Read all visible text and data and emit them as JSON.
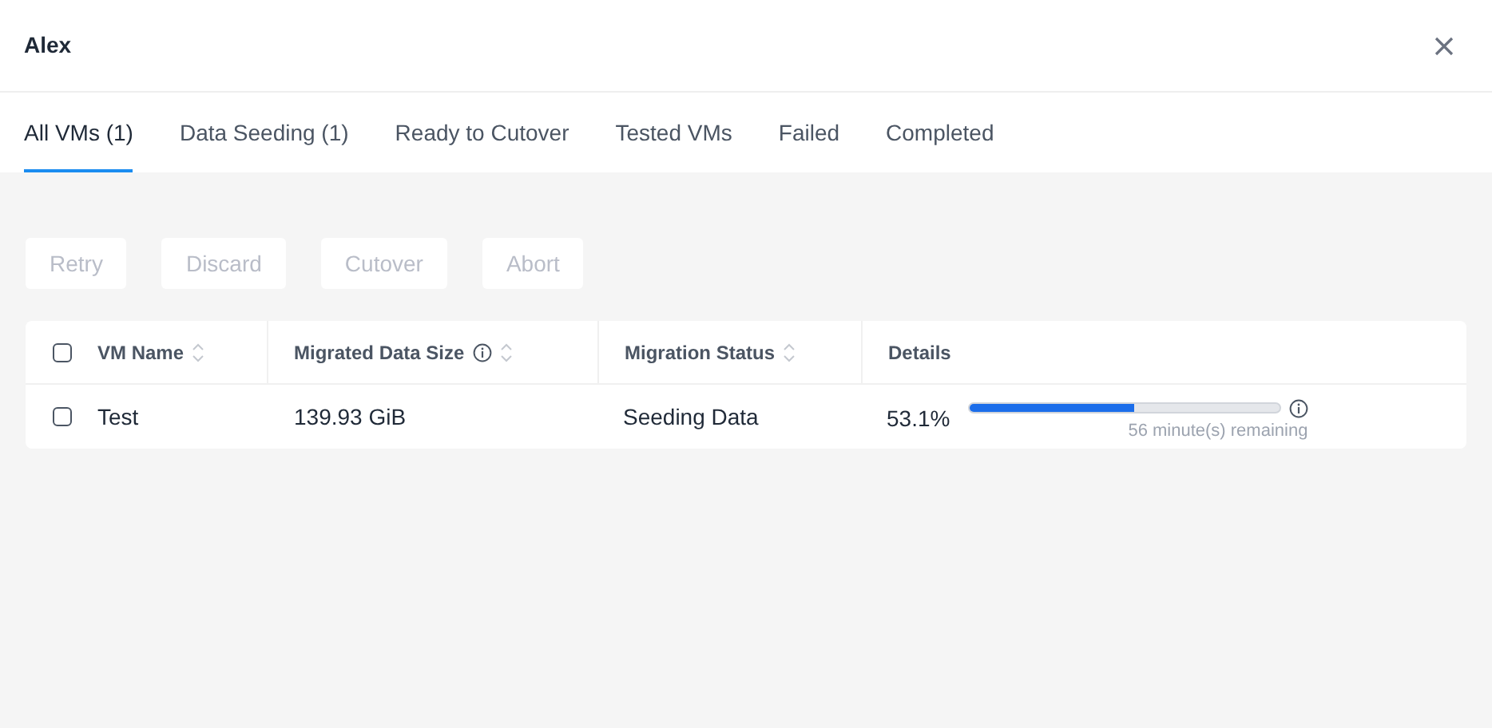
{
  "dialog": {
    "title": "Alex"
  },
  "tabs": [
    {
      "label": "All VMs (1)",
      "selected": true
    },
    {
      "label": "Data Seeding (1)",
      "selected": false
    },
    {
      "label": "Ready to Cutover",
      "selected": false
    },
    {
      "label": "Tested VMs",
      "selected": false
    },
    {
      "label": "Failed",
      "selected": false
    },
    {
      "label": "Completed",
      "selected": false
    }
  ],
  "actions": [
    {
      "label": "Retry",
      "disabled": true
    },
    {
      "label": "Discard",
      "disabled": true
    },
    {
      "label": "Cutover",
      "disabled": true
    },
    {
      "label": "Abort",
      "disabled": true
    }
  ],
  "table": {
    "select_all_checked": false,
    "columns": [
      {
        "label": "VM Name",
        "sortable": true,
        "info": false
      },
      {
        "label": "Migrated Data Size",
        "sortable": true,
        "info": true
      },
      {
        "label": "Migration Status",
        "sortable": true,
        "info": false
      },
      {
        "label": "Details",
        "sortable": false,
        "info": false
      }
    ],
    "rows": [
      {
        "checked": false,
        "name": "Test",
        "size": "139.93 GiB",
        "status": "Seeding Data",
        "percent": "53.1%",
        "level": 0.531,
        "remaining": "56 minute(s) remaining"
      }
    ]
  }
}
